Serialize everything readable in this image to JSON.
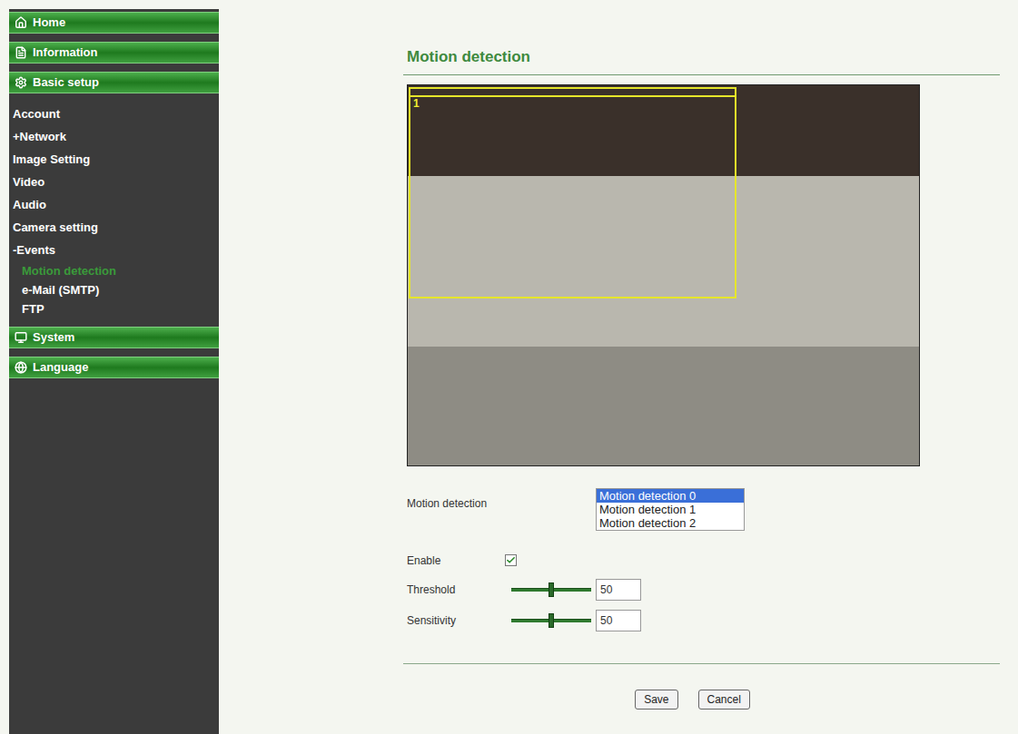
{
  "sidebar": {
    "items": [
      {
        "label": "Home",
        "kind": "header",
        "selected": false
      },
      {
        "label": "Information",
        "kind": "header",
        "selected": false
      },
      {
        "label": "Basic setup",
        "kind": "header",
        "selected": false
      },
      {
        "label": "Account",
        "kind": "item",
        "selected": false
      },
      {
        "label": "+Network",
        "kind": "item",
        "selected": false
      },
      {
        "label": "Image Setting",
        "kind": "item",
        "selected": false
      },
      {
        "label": "Video",
        "kind": "item",
        "selected": false
      },
      {
        "label": "Audio",
        "kind": "item",
        "selected": false
      },
      {
        "label": "Camera setting",
        "kind": "item",
        "selected": false
      },
      {
        "label": "-Events",
        "kind": "item",
        "selected": false
      },
      {
        "label": "Motion detection",
        "kind": "subitem",
        "selected": true
      },
      {
        "label": "e-Mail (SMTP)",
        "kind": "subitem",
        "selected": false
      },
      {
        "label": "FTP",
        "kind": "subitem",
        "selected": false
      },
      {
        "label": "System",
        "kind": "header",
        "selected": false
      },
      {
        "label": "Language",
        "kind": "header",
        "selected": false
      }
    ]
  },
  "page": {
    "title": "Motion detection"
  },
  "preview": {
    "regions": [
      {
        "label": "1"
      }
    ]
  },
  "form": {
    "motion_detection": {
      "label": "Motion detection",
      "options": [
        {
          "label": "Motion detection 0",
          "selected": true
        },
        {
          "label": "Motion detection 1",
          "selected": false
        },
        {
          "label": "Motion detection 2",
          "selected": false
        }
      ]
    },
    "enable": {
      "label": "Enable",
      "checked": true
    },
    "sliders": [
      {
        "label": "Threshold",
        "level": 0.5,
        "value": "50"
      },
      {
        "label": "Sensitivity",
        "level": 0.5,
        "value": "50"
      }
    ]
  },
  "buttons": [
    "Save",
    "Cancel"
  ]
}
